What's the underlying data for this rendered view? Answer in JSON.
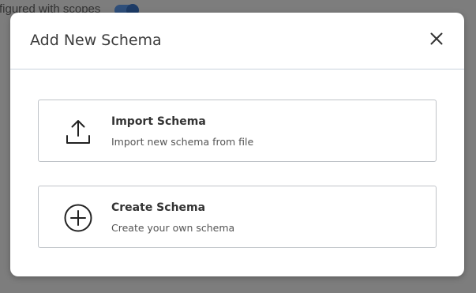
{
  "background": {
    "partial_text": "figured with scopes",
    "toggle_state": "on"
  },
  "modal": {
    "title": "Add New Schema",
    "close_icon": "close-icon",
    "options": [
      {
        "icon": "upload-icon",
        "title": "Import Schema",
        "description": "Import new schema from file"
      },
      {
        "icon": "plus-circle-icon",
        "title": "Create Schema",
        "description": "Create your own schema"
      }
    ]
  },
  "colors": {
    "overlay": "#7d7d7d",
    "toggle": "#1d3b66",
    "card_border": "#bfc3c8",
    "header_divider": "#c9d2dc"
  }
}
